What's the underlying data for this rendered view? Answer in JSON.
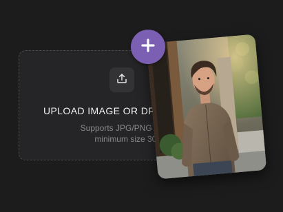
{
  "upload": {
    "title": "UPLOAD IMAGE OR DRAG",
    "hint_line1": "Supports JPG/PNG formats,",
    "hint_line2": "minimum size 300px"
  },
  "icons": {
    "upload": "upload-icon",
    "add": "plus-icon"
  },
  "colors": {
    "background": "#1c1c1d",
    "dropzone": "#252527",
    "accent": "#7b5fb3"
  }
}
